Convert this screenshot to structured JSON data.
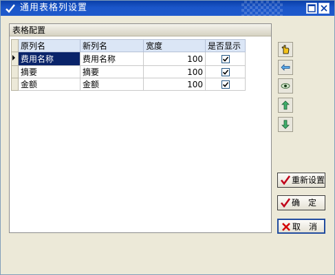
{
  "window": {
    "title": "通用表格列设置"
  },
  "panel": {
    "caption": "表格配置"
  },
  "grid": {
    "columns": [
      "原列名",
      "新列名",
      "宽度",
      "是否显示"
    ],
    "rows": [
      {
        "original": "费用名称",
        "new_name": "费用名称",
        "width": "100",
        "visible": true
      },
      {
        "original": "摘要",
        "new_name": "摘要",
        "width": "100",
        "visible": true
      },
      {
        "original": "金额",
        "new_name": "金额",
        "width": "100",
        "visible": true
      }
    ]
  },
  "toolbar_icons": [
    "pointer-hand-icon",
    "arrow-left-icon",
    "eye-icon",
    "arrow-up-icon",
    "arrow-down-icon"
  ],
  "buttons": {
    "reset": "重新设置",
    "ok": "确　定",
    "cancel": "取　消"
  },
  "colors": {
    "title_bar": "#0a3fa8",
    "selected_cell": "#0a246a",
    "header_bg": "#dbe6f6",
    "check_mark": "#c0001a",
    "cancel_x": "#d40000"
  }
}
